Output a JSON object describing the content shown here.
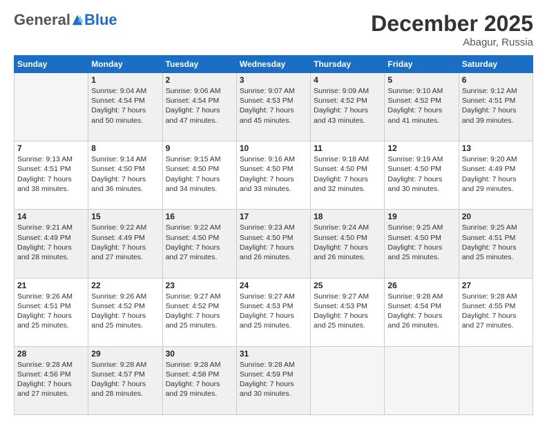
{
  "header": {
    "logo_general": "General",
    "logo_blue": "Blue",
    "month_title": "December 2025",
    "location": "Abagur, Russia"
  },
  "weekdays": [
    "Sunday",
    "Monday",
    "Tuesday",
    "Wednesday",
    "Thursday",
    "Friday",
    "Saturday"
  ],
  "weeks": [
    [
      {
        "day": "",
        "info": ""
      },
      {
        "day": "1",
        "info": "Sunrise: 9:04 AM\nSunset: 4:54 PM\nDaylight: 7 hours\nand 50 minutes."
      },
      {
        "day": "2",
        "info": "Sunrise: 9:06 AM\nSunset: 4:54 PM\nDaylight: 7 hours\nand 47 minutes."
      },
      {
        "day": "3",
        "info": "Sunrise: 9:07 AM\nSunset: 4:53 PM\nDaylight: 7 hours\nand 45 minutes."
      },
      {
        "day": "4",
        "info": "Sunrise: 9:09 AM\nSunset: 4:52 PM\nDaylight: 7 hours\nand 43 minutes."
      },
      {
        "day": "5",
        "info": "Sunrise: 9:10 AM\nSunset: 4:52 PM\nDaylight: 7 hours\nand 41 minutes."
      },
      {
        "day": "6",
        "info": "Sunrise: 9:12 AM\nSunset: 4:51 PM\nDaylight: 7 hours\nand 39 minutes."
      }
    ],
    [
      {
        "day": "7",
        "info": "Sunrise: 9:13 AM\nSunset: 4:51 PM\nDaylight: 7 hours\nand 38 minutes."
      },
      {
        "day": "8",
        "info": "Sunrise: 9:14 AM\nSunset: 4:50 PM\nDaylight: 7 hours\nand 36 minutes."
      },
      {
        "day": "9",
        "info": "Sunrise: 9:15 AM\nSunset: 4:50 PM\nDaylight: 7 hours\nand 34 minutes."
      },
      {
        "day": "10",
        "info": "Sunrise: 9:16 AM\nSunset: 4:50 PM\nDaylight: 7 hours\nand 33 minutes."
      },
      {
        "day": "11",
        "info": "Sunrise: 9:18 AM\nSunset: 4:50 PM\nDaylight: 7 hours\nand 32 minutes."
      },
      {
        "day": "12",
        "info": "Sunrise: 9:19 AM\nSunset: 4:50 PM\nDaylight: 7 hours\nand 30 minutes."
      },
      {
        "day": "13",
        "info": "Sunrise: 9:20 AM\nSunset: 4:49 PM\nDaylight: 7 hours\nand 29 minutes."
      }
    ],
    [
      {
        "day": "14",
        "info": "Sunrise: 9:21 AM\nSunset: 4:49 PM\nDaylight: 7 hours\nand 28 minutes."
      },
      {
        "day": "15",
        "info": "Sunrise: 9:22 AM\nSunset: 4:49 PM\nDaylight: 7 hours\nand 27 minutes."
      },
      {
        "day": "16",
        "info": "Sunrise: 9:22 AM\nSunset: 4:50 PM\nDaylight: 7 hours\nand 27 minutes."
      },
      {
        "day": "17",
        "info": "Sunrise: 9:23 AM\nSunset: 4:50 PM\nDaylight: 7 hours\nand 26 minutes."
      },
      {
        "day": "18",
        "info": "Sunrise: 9:24 AM\nSunset: 4:50 PM\nDaylight: 7 hours\nand 26 minutes."
      },
      {
        "day": "19",
        "info": "Sunrise: 9:25 AM\nSunset: 4:50 PM\nDaylight: 7 hours\nand 25 minutes."
      },
      {
        "day": "20",
        "info": "Sunrise: 9:25 AM\nSunset: 4:51 PM\nDaylight: 7 hours\nand 25 minutes."
      }
    ],
    [
      {
        "day": "21",
        "info": "Sunrise: 9:26 AM\nSunset: 4:51 PM\nDaylight: 7 hours\nand 25 minutes."
      },
      {
        "day": "22",
        "info": "Sunrise: 9:26 AM\nSunset: 4:52 PM\nDaylight: 7 hours\nand 25 minutes."
      },
      {
        "day": "23",
        "info": "Sunrise: 9:27 AM\nSunset: 4:52 PM\nDaylight: 7 hours\nand 25 minutes."
      },
      {
        "day": "24",
        "info": "Sunrise: 9:27 AM\nSunset: 4:53 PM\nDaylight: 7 hours\nand 25 minutes."
      },
      {
        "day": "25",
        "info": "Sunrise: 9:27 AM\nSunset: 4:53 PM\nDaylight: 7 hours\nand 25 minutes."
      },
      {
        "day": "26",
        "info": "Sunrise: 9:28 AM\nSunset: 4:54 PM\nDaylight: 7 hours\nand 26 minutes."
      },
      {
        "day": "27",
        "info": "Sunrise: 9:28 AM\nSunset: 4:55 PM\nDaylight: 7 hours\nand 27 minutes."
      }
    ],
    [
      {
        "day": "28",
        "info": "Sunrise: 9:28 AM\nSunset: 4:56 PM\nDaylight: 7 hours\nand 27 minutes."
      },
      {
        "day": "29",
        "info": "Sunrise: 9:28 AM\nSunset: 4:57 PM\nDaylight: 7 hours\nand 28 minutes."
      },
      {
        "day": "30",
        "info": "Sunrise: 9:28 AM\nSunset: 4:58 PM\nDaylight: 7 hours\nand 29 minutes."
      },
      {
        "day": "31",
        "info": "Sunrise: 9:28 AM\nSunset: 4:59 PM\nDaylight: 7 hours\nand 30 minutes."
      },
      {
        "day": "",
        "info": ""
      },
      {
        "day": "",
        "info": ""
      },
      {
        "day": "",
        "info": ""
      }
    ]
  ],
  "row_styles": [
    "shaded",
    "white",
    "shaded",
    "white",
    "shaded"
  ]
}
